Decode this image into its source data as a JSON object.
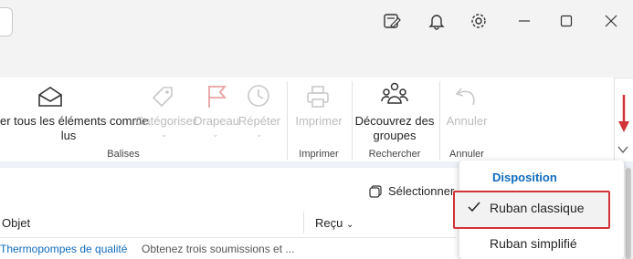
{
  "ribbon": {
    "mark_all_read_line1": "er tous les éléments comme",
    "mark_all_read_line2": "lus",
    "categorize": "Catégoriser",
    "flag": "Drapeau",
    "repeat": "Répéter",
    "print": "Imprimer",
    "discover_groups_line1": "Découvrez des",
    "discover_groups_line2": "groupes",
    "undo": "Annuler",
    "groups": {
      "tags": "Balises",
      "print": "Imprimer",
      "search": "Rechercher",
      "undo": "Annuler"
    }
  },
  "list": {
    "select_label": "Sélectionner",
    "col_subject": "Objet",
    "col_received": "Reçu",
    "row_sender": "Thermopompes de qualité",
    "row_preview": "Obtenez trois soumissions et ..."
  },
  "menu": {
    "header": "Disposition",
    "items": [
      {
        "label": "Ruban classique",
        "checked": true
      },
      {
        "label": "Ruban simplifié",
        "checked": false
      }
    ]
  },
  "colors": {
    "accent": "#0f6cbd",
    "highlight_border": "#d13438",
    "annotation_arrow": "#d13438",
    "disabled": "#bcbcbc"
  },
  "icons": [
    "compose-note-icon",
    "bell-icon",
    "gear-icon",
    "minimize-icon",
    "maximize-icon",
    "close-icon",
    "envelope-open-icon",
    "tag-icon",
    "flag-icon",
    "clock-icon",
    "printer-icon",
    "people-group-icon",
    "undo-icon",
    "chevron-down-icon",
    "select-icon",
    "checkmark-icon"
  ]
}
